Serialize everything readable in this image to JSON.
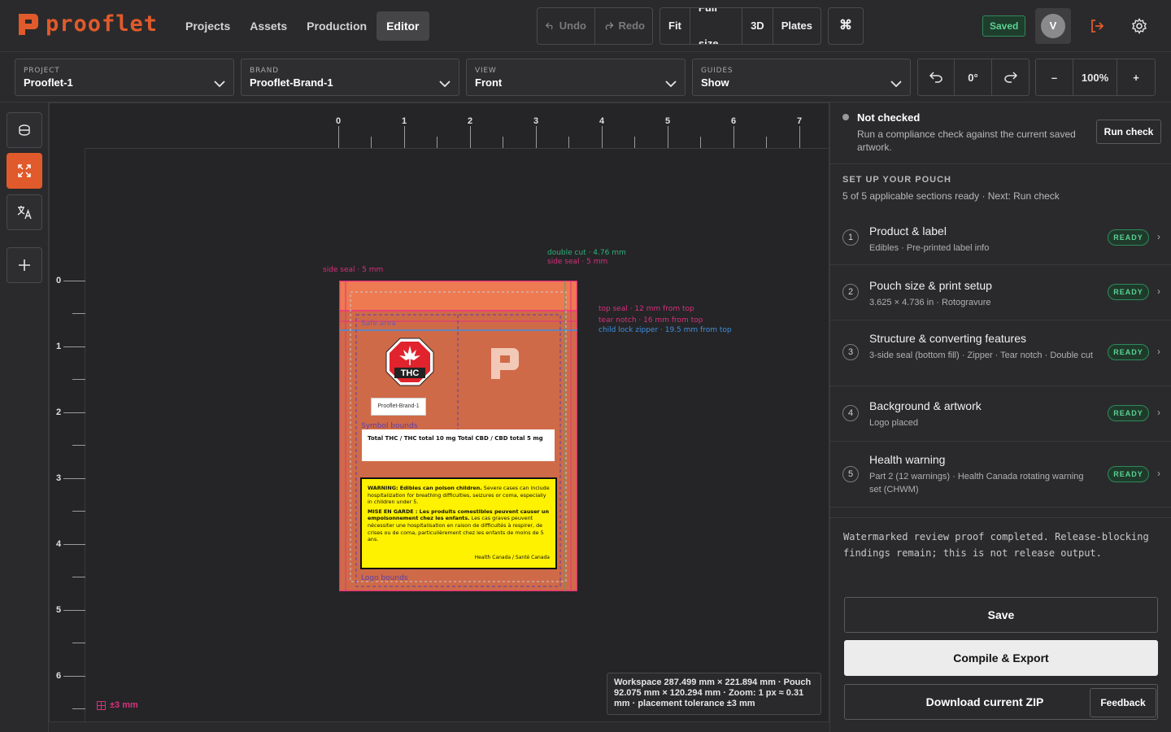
{
  "brand": {
    "name": "prooflet",
    "accent": "#e05a2b"
  },
  "nav": {
    "items": [
      "Projects",
      "Assets",
      "Production",
      "Editor"
    ],
    "active": "Editor"
  },
  "history": {
    "undo": "Undo",
    "redo": "Redo"
  },
  "view_modes": [
    "Fit",
    "Full size",
    "3D",
    "Plates"
  ],
  "command_icon": "command-icon",
  "save_status": "Saved",
  "user": {
    "initial": "V"
  },
  "selectors": {
    "project": {
      "caption": "PROJECT",
      "value": "Prooflet-1"
    },
    "brand": {
      "caption": "BRAND",
      "value": "Prooflet-Brand-1"
    },
    "view": {
      "caption": "VIEW",
      "value": "Front"
    },
    "guides": {
      "caption": "GUIDES",
      "value": "Show"
    }
  },
  "rotation": {
    "value": "0°"
  },
  "zoom": {
    "minus": "–",
    "value": "100%",
    "plus": "+"
  },
  "rail": [
    "layers-icon",
    "fit-expand-icon",
    "translate-icon",
    "plus-icon"
  ],
  "ruler": {
    "top": [
      "0",
      "1",
      "2",
      "3",
      "4",
      "5",
      "6",
      "7"
    ],
    "left": [
      "0",
      "1",
      "2",
      "3",
      "4",
      "5",
      "6"
    ]
  },
  "canvas": {
    "tolerance": "±3 mm",
    "workspace_info": "Workspace 287.499 mm × 221.894 mm · Pouch 92.075 mm × 120.294 mm · Zoom: 1 px ≈ 0.31 mm · placement tolerance ±3 mm",
    "annotations": {
      "double_cut": "double cut · 4.76 mm",
      "side_seal_right": "side seal · 5 mm",
      "side_seal_left": "side seal · 5 mm",
      "top_seal": "top seal · 12 mm from top",
      "tear_notch": "tear notch · 16 mm from top",
      "zipper": "child lock zipper · 19.5 mm from top",
      "safe_area": "Safe area",
      "symbol_bounds": "Symbol bounds",
      "logo_bounds": "Logo bounds"
    },
    "label": {
      "thc_symbol": "THC",
      "brand": "Prooflet-Brand-1",
      "cannabinoid": "Total THC / THC total 10 mg Total CBD / CBD total 5 mg",
      "warning_en_bold": "WARNING: Edibles can poison children.",
      "warning_en": " Severe cases can include hospitalization for breathing difficulties, seizures or coma, especially in children under 5.",
      "warning_fr_bold": "MISE EN GARDE : Les produits comestibles peuvent causer un empoisonnement chez les enfants.",
      "warning_fr": " Les cas graves peuvent nécessiter une hospitalisation en raison de difficultés à respirer, de crises ou de coma, particulièrement chez les enfants de moins de 5 ans.",
      "warning_source": "Health Canada / Santé Canada"
    }
  },
  "panel": {
    "status": {
      "title": "Not checked",
      "desc": "Run a compliance check against the current saved artwork.",
      "button": "Run check"
    },
    "setup": {
      "heading": "SET UP YOUR POUCH",
      "sub": "5 of 5 applicable sections ready · Next: Run check",
      "steps": [
        {
          "num": "1",
          "title": "Product & label",
          "sub": "Edibles · Pre-printed label info",
          "status": "READY"
        },
        {
          "num": "2",
          "title": "Pouch size & print setup",
          "sub": "3.625 × 4.736 in · Rotogravure",
          "status": "READY"
        },
        {
          "num": "3",
          "title": "Structure & converting features",
          "sub": "3-side seal (bottom fill) · Zipper · Tear notch · Double cut",
          "status": "READY"
        },
        {
          "num": "4",
          "title": "Background & artwork",
          "sub": "Logo placed",
          "status": "READY"
        },
        {
          "num": "5",
          "title": "Health warning",
          "sub": "Part 2 (12 warnings) · Health Canada rotating warning set (CHWM)",
          "status": "READY"
        }
      ],
      "chevron": "›"
    },
    "note": "Watermarked review proof completed. Release-blocking findings remain; this is not release output.",
    "actions": {
      "save": "Save",
      "compile": "Compile & Export",
      "download": "Download current ZIP",
      "feedback": "Feedback"
    }
  }
}
